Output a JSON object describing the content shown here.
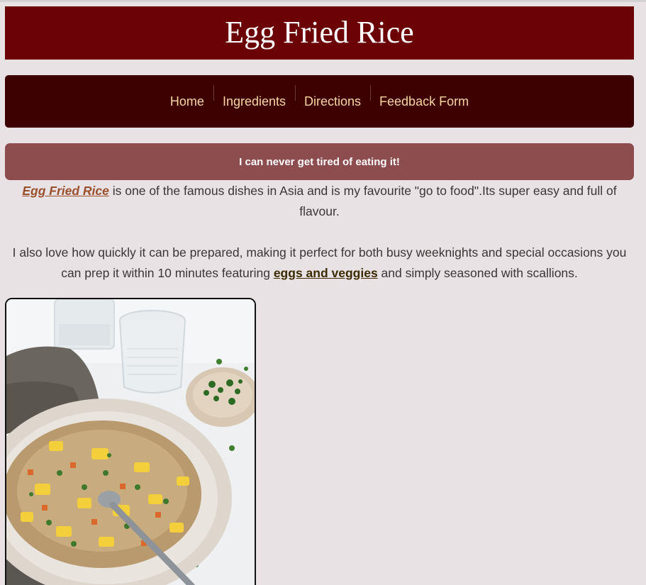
{
  "header": {
    "title": "Egg Fried Rice"
  },
  "nav": {
    "items": [
      {
        "label": "Home"
      },
      {
        "label": "Ingredients"
      },
      {
        "label": "Directions"
      },
      {
        "label": "Feedback Form"
      }
    ]
  },
  "tagline": "I can never get tired of eating it!",
  "intro": {
    "p1_link": "Egg Fried Rice",
    "p1_text": " is one of the famous dishes in Asia and is my favourite \"go to food\".Its super easy and full of flavour.",
    "p2_text_a": "I also love how quickly it can be prepared, making it perfect for both busy weeknights and special occasions you can prep it within 10 minutes featuring ",
    "p2_link": "eggs and veggies",
    "p2_text_b": " and simply seasoned with scallions."
  },
  "colors": {
    "title_bg": "#6b0306",
    "nav_bg": "#3d0102",
    "nav_text": "#f7d6a3",
    "tagline_bg": "#8d4c4e",
    "page_bg": "#e8e2e5"
  }
}
